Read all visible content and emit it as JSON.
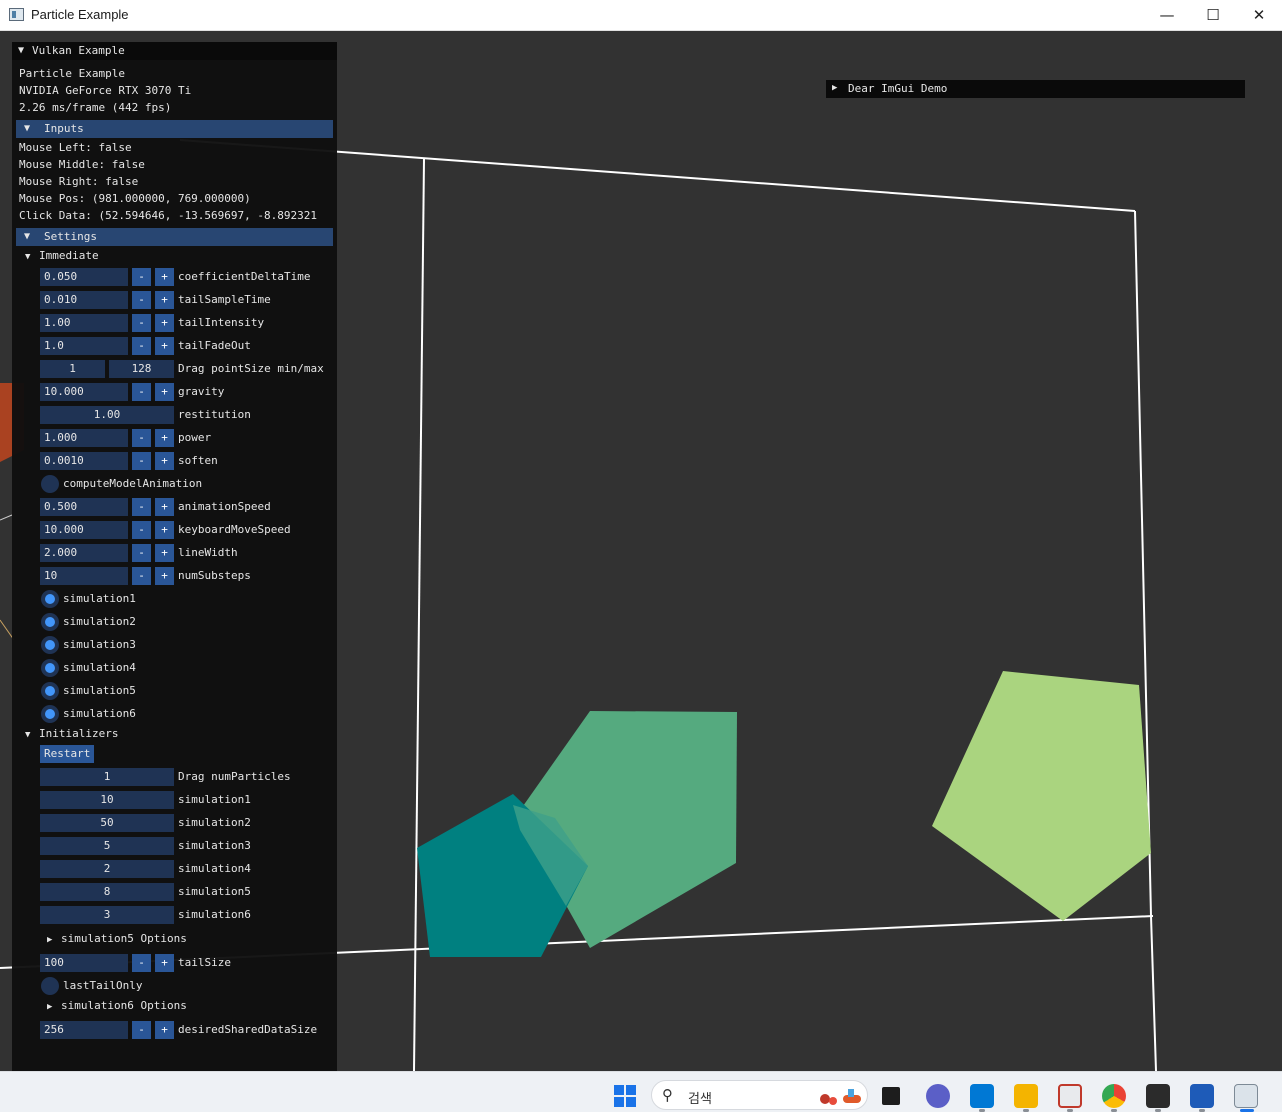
{
  "window": {
    "title": "Particle Example",
    "minimize": "—",
    "maximize": "☐",
    "close": "✕"
  },
  "imgui_window": {
    "title": "Vulkan Example",
    "app_name": "Particle Example",
    "gpu": "NVIDIA GeForce RTX 3070 Ti",
    "frame_time": "2.26 ms/frame (442 fps)",
    "inputs_header": "Inputs",
    "inputs": [
      "Mouse Left: false",
      "Mouse Middle: false",
      "Mouse Right: false",
      "Mouse Pos: (981.000000, 769.000000)",
      "Click Data: (52.594646, -13.569697, -8.892321"
    ],
    "settings_header": "Settings",
    "immediate_label": "Immediate",
    "minus": "-",
    "plus": "+",
    "coefficientDeltaTime": {
      "value": "0.050",
      "label": "coefficientDeltaTime"
    },
    "tailSampleTime": {
      "value": "0.010",
      "label": "tailSampleTime"
    },
    "tailIntensity": {
      "value": "1.00",
      "label": "tailIntensity"
    },
    "tailFadeOut": {
      "value": "1.0",
      "label": "tailFadeOut"
    },
    "pointSize": {
      "min": "1",
      "max": "128",
      "label": "Drag pointSize min/max"
    },
    "gravity": {
      "value": "10.000",
      "label": "gravity"
    },
    "restitution": {
      "value": "1.00",
      "label": "restitution"
    },
    "power": {
      "value": "1.000",
      "label": "power"
    },
    "soften": {
      "value": "0.0010",
      "label": "soften"
    },
    "computeModelAnimation": {
      "label": "computeModelAnimation",
      "checked": false
    },
    "animationSpeed": {
      "value": "0.500",
      "label": "animationSpeed"
    },
    "keyboardMoveSpeed": {
      "value": "10.000",
      "label": "keyboardMoveSpeed"
    },
    "lineWidth": {
      "value": "2.000",
      "label": "lineWidth"
    },
    "numSubsteps": {
      "value": "10",
      "label": "numSubsteps"
    },
    "simulations": [
      {
        "label": "simulation1",
        "checked": true
      },
      {
        "label": "simulation2",
        "checked": true
      },
      {
        "label": "simulation3",
        "checked": true
      },
      {
        "label": "simulation4",
        "checked": true
      },
      {
        "label": "simulation5",
        "checked": true
      },
      {
        "label": "simulation6",
        "checked": true
      }
    ],
    "initializers_label": "Initializers",
    "restart_label": "Restart",
    "numParticles": {
      "value": "1",
      "label": "Drag numParticles"
    },
    "sim_counts": [
      {
        "value": "10",
        "label": "simulation1"
      },
      {
        "value": "50",
        "label": "simulation2"
      },
      {
        "value": "5",
        "label": "simulation3"
      },
      {
        "value": "2",
        "label": "simulation4"
      },
      {
        "value": "8",
        "label": "simulation5"
      },
      {
        "value": "3",
        "label": "simulation6"
      }
    ],
    "sim5_options": "simulation5 Options",
    "tailSize": {
      "value": "100",
      "label": "tailSize"
    },
    "lastTailOnly": {
      "label": "lastTailOnly",
      "checked": false
    },
    "sim6_options": "simulation6 Options",
    "desiredSharedDataSize": {
      "value": "256",
      "label": "desiredSharedDataSize"
    }
  },
  "demo_window": {
    "title": "Dear ImGui Demo"
  },
  "taskbar": {
    "search_placeholder": "검색",
    "apps": [
      "start-icon",
      "task-view-icon",
      "teams-chat-icon",
      "vscode-icon",
      "file-explorer-icon",
      "snipping-tool-icon",
      "chrome-icon",
      "terminal-icon",
      "whiteboard-icon",
      "particle-app-icon"
    ]
  },
  "colors": {
    "background": "#323232",
    "panel": "#0f0f0f",
    "header": "#284672",
    "frame": "#1f3354",
    "button": "#2a5697",
    "check": "#4296fa",
    "teal_shape": "#008080",
    "green_shape": "#55aa7f",
    "lime_shape": "#aad47f"
  }
}
